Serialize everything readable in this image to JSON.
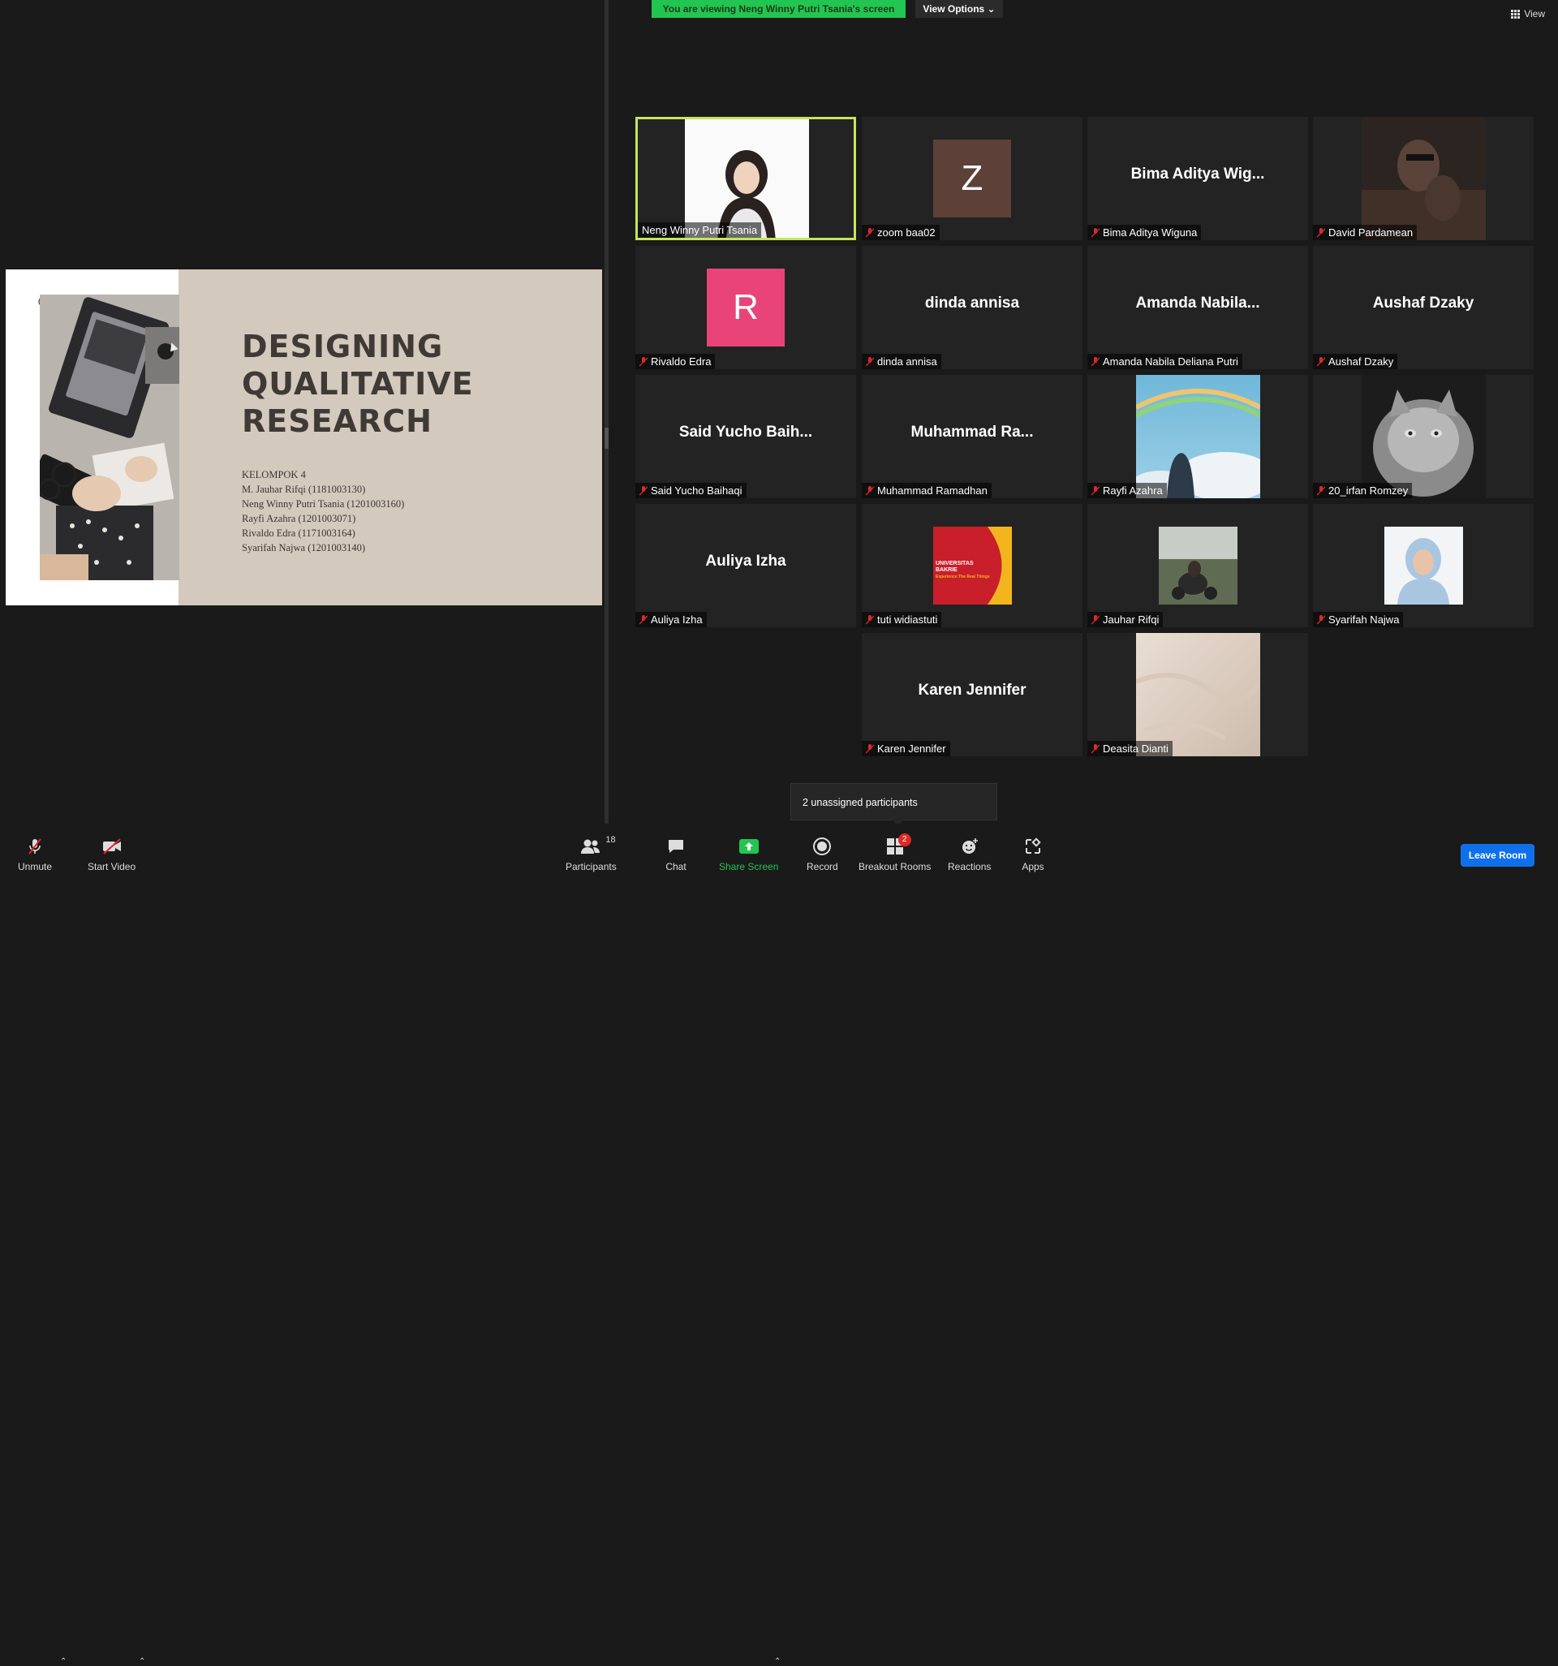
{
  "banner": {
    "text": "You are viewing Neng Winny Putri Tsania's screen",
    "view_options": "View Options ⌄"
  },
  "view_button": "View",
  "slide": {
    "number": "01",
    "title_lines": [
      "DESIGNING",
      "QUALITATIVE",
      "RESEARCH"
    ],
    "group": "KELOMPOK 4",
    "members": [
      "M. Jauhar Rifqi (1181003130)",
      "Neng Winny Putri Tsania (1201003160)",
      "Rayfi Azahra (1201003071)",
      "Rivaldo Edra (1171003164)",
      "Syarifah Najwa (1201003140)"
    ]
  },
  "tiles": [
    {
      "name": "Neng Winny Putri Tsania",
      "big": "",
      "avatar": "",
      "muted": false,
      "kind": "video-hijab"
    },
    {
      "name": "zoom baa02",
      "big": "",
      "avatar": "Z",
      "muted": true,
      "kind": "avatar"
    },
    {
      "name": "Bima Aditya Wiguna",
      "big": "Bima Aditya Wig...",
      "avatar": "",
      "muted": true,
      "kind": "text"
    },
    {
      "name": "David Pardamean",
      "big": "",
      "avatar": "",
      "muted": true,
      "kind": "video-dark"
    },
    {
      "name": "Rivaldo Edra",
      "big": "",
      "avatar": "R",
      "muted": true,
      "kind": "avatar"
    },
    {
      "name": "dinda annisa",
      "big": "dinda annisa",
      "avatar": "",
      "muted": true,
      "kind": "text"
    },
    {
      "name": "Amanda Nabila Deliana Putri",
      "big": "Amanda  Nabila...",
      "avatar": "",
      "muted": true,
      "kind": "text"
    },
    {
      "name": "Aushaf Dzaky",
      "big": "Aushaf Dzaky",
      "avatar": "",
      "muted": true,
      "kind": "text"
    },
    {
      "name": "Said Yucho Baihaqi",
      "big": "Said  Yucho Baih...",
      "avatar": "",
      "muted": true,
      "kind": "text"
    },
    {
      "name": "Muhammad Ramadhan",
      "big": "Muhammad  Ra...",
      "avatar": "",
      "muted": true,
      "kind": "text"
    },
    {
      "name": "Rayfi Azahra",
      "big": "",
      "avatar": "",
      "muted": true,
      "kind": "video-sky"
    },
    {
      "name": "20_irfan Romzey",
      "big": "",
      "avatar": "",
      "muted": true,
      "kind": "video-cat"
    },
    {
      "name": "Auliya Izha",
      "big": "Auliya Izha",
      "avatar": "",
      "muted": true,
      "kind": "text"
    },
    {
      "name": "tuti widiastuti",
      "big": "",
      "avatar": "",
      "muted": true,
      "kind": "logo"
    },
    {
      "name": "Jauhar Rifqi",
      "big": "",
      "avatar": "",
      "muted": true,
      "kind": "video-bike"
    },
    {
      "name": "Syarifah Najwa",
      "big": "",
      "avatar": "",
      "muted": true,
      "kind": "video-hijab2"
    },
    {
      "name": "Karen Jennifer",
      "big": "Karen Jennifer",
      "avatar": "",
      "muted": true,
      "kind": "text"
    },
    {
      "name": "Deasita Dianti",
      "big": "",
      "avatar": "",
      "muted": true,
      "kind": "video-marble"
    }
  ],
  "logo_text": {
    "line1": "UNIVERSITAS",
    "line2": "BAKRIE",
    "line3": "Experience The Real Things"
  },
  "tooltip": "2 unassigned participants",
  "toolbar": {
    "unmute": "Unmute",
    "start_video": "Start Video",
    "participants": "Participants",
    "participants_count": "18",
    "chat": "Chat",
    "share_screen": "Share Screen",
    "record": "Record",
    "breakout_rooms": "Breakout Rooms",
    "breakout_badge": "2",
    "reactions": "Reactions",
    "apps": "Apps",
    "leave_room": "Leave Room"
  },
  "colors": {
    "active_border": "#c7e35b",
    "banner": "#23c552",
    "leave": "#0e71eb",
    "avatar_z": "#5d4037",
    "avatar_r": "#e8447a",
    "share": "#23c552"
  }
}
